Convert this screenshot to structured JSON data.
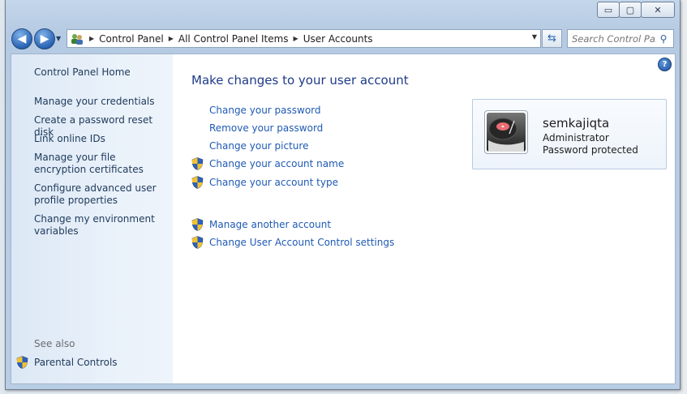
{
  "window": {
    "controls": {
      "minimize": "▭",
      "maximize": "▢",
      "close": "✕"
    }
  },
  "nav": {
    "back_glyph": "◀",
    "forward_glyph": "▶",
    "breadcrumbs": [
      "Control Panel",
      "All Control Panel Items",
      "User Accounts"
    ],
    "search_placeholder": "Search Control Pa..."
  },
  "sidebar": {
    "home": "Control Panel Home",
    "links": [
      "Manage your credentials",
      "Create a password reset disk",
      "Link online IDs",
      "Manage your file encryption certificates",
      "Configure advanced user profile properties",
      "Change my environment variables"
    ],
    "see_also": "See also",
    "parental_controls": "Parental Controls"
  },
  "main": {
    "heading": "Make changes to your user account",
    "tasks": [
      "Change your password",
      "Remove your password",
      "Change your picture",
      "Change your account name",
      "Change your account type"
    ],
    "other_tasks": [
      "Manage another account",
      "Change User Account Control settings"
    ]
  },
  "account": {
    "name": "semkajiqta",
    "role": "Administrator",
    "status": "Password protected"
  },
  "colors": {
    "link": "#1f5ab3",
    "heading": "#1e3a8a",
    "sidebar_link": "#1e395b"
  }
}
